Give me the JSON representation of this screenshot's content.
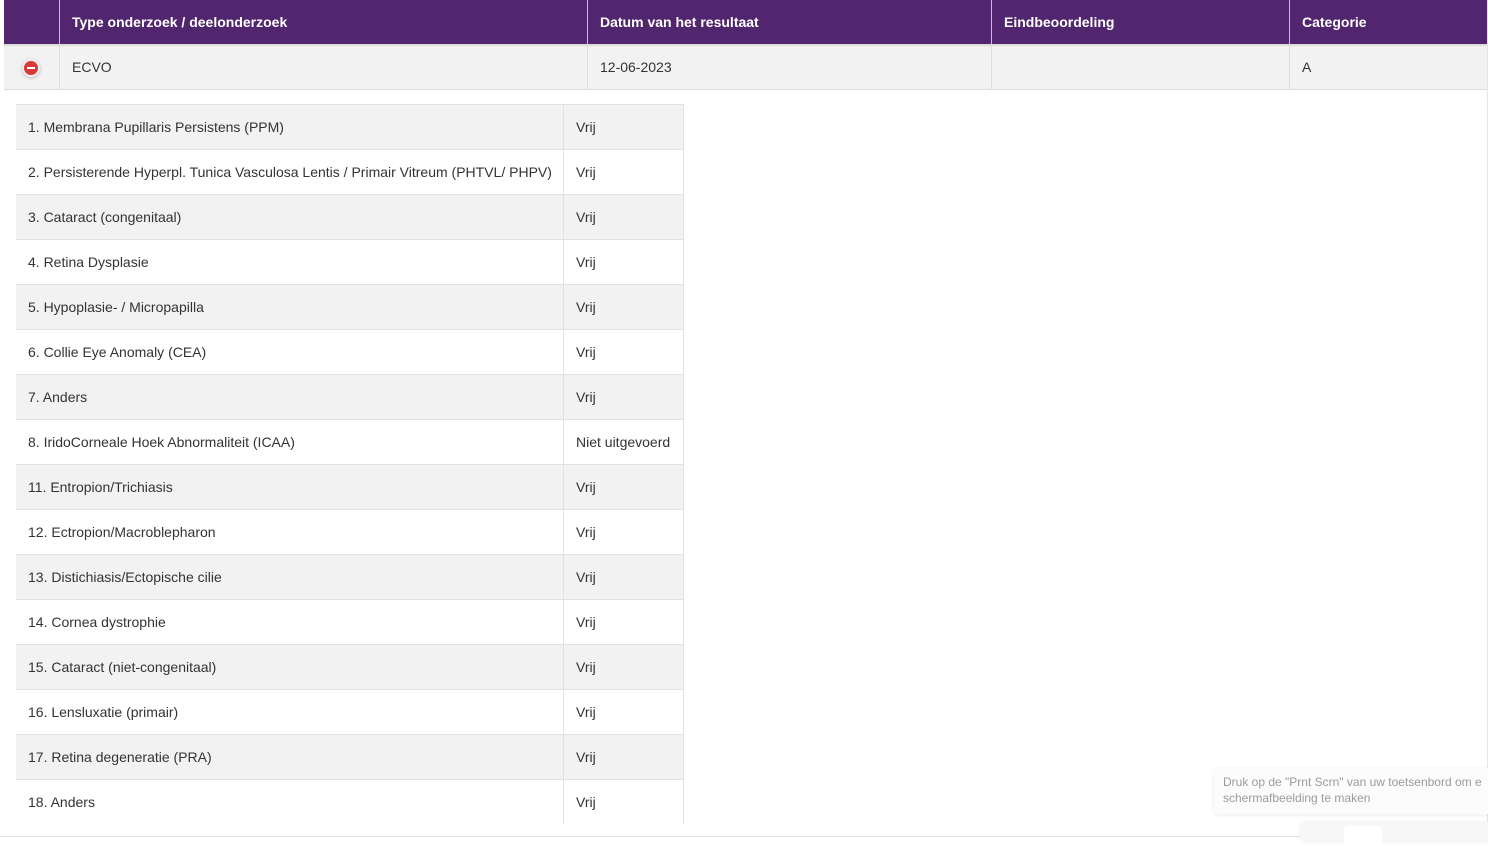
{
  "header": {
    "columns": [
      "",
      "Type onderzoek / deelonderzoek",
      "Datum van het resultaat",
      "Eindbeoordeling",
      "Categorie"
    ]
  },
  "row": {
    "type": "ECVO",
    "date": "12-06-2023",
    "final": "",
    "category": "A",
    "toggle_icon": "collapse-minus-icon",
    "icon_color": "#d63a3a"
  },
  "accent": "#52266e",
  "details": [
    {
      "name": "1. Membrana Pupillaris Persistens (PPM)",
      "result": "Vrij"
    },
    {
      "name": "2. Persisterende Hyperpl. Tunica Vasculosa Lentis / Primair Vitreum (PHTVL/ PHPV)",
      "result": "Vrij"
    },
    {
      "name": "3. Cataract (congenitaal)",
      "result": "Vrij"
    },
    {
      "name": "4. Retina Dysplasie",
      "result": "Vrij"
    },
    {
      "name": "5. Hypoplasie- / Micropapilla",
      "result": "Vrij"
    },
    {
      "name": "6. Collie Eye Anomaly (CEA)",
      "result": "Vrij"
    },
    {
      "name": "7. Anders",
      "result": "Vrij"
    },
    {
      "name": "8. IridoCorneale Hoek Abnormaliteit (ICAA)",
      "result": "Niet uitgevoerd"
    },
    {
      "name": "11. Entropion/Trichiasis",
      "result": "Vrij"
    },
    {
      "name": "12. Ectropion/Macroblepharon",
      "result": "Vrij"
    },
    {
      "name": "13. Distichiasis/Ectopische cilie",
      "result": "Vrij"
    },
    {
      "name": "14. Cornea dystrophie",
      "result": "Vrij"
    },
    {
      "name": "15. Cataract (niet-congenitaal)",
      "result": "Vrij"
    },
    {
      "name": "16. Lensluxatie (primair)",
      "result": "Vrij"
    },
    {
      "name": "17. Retina degeneratie (PRA)",
      "result": "Vrij"
    },
    {
      "name": "18. Anders",
      "result": "Vrij"
    }
  ],
  "tooltip": {
    "line1": "Druk op de \"Prnt Scrn\" van uw toetsenbord om e",
    "line2": "schermafbeelding te maken"
  }
}
